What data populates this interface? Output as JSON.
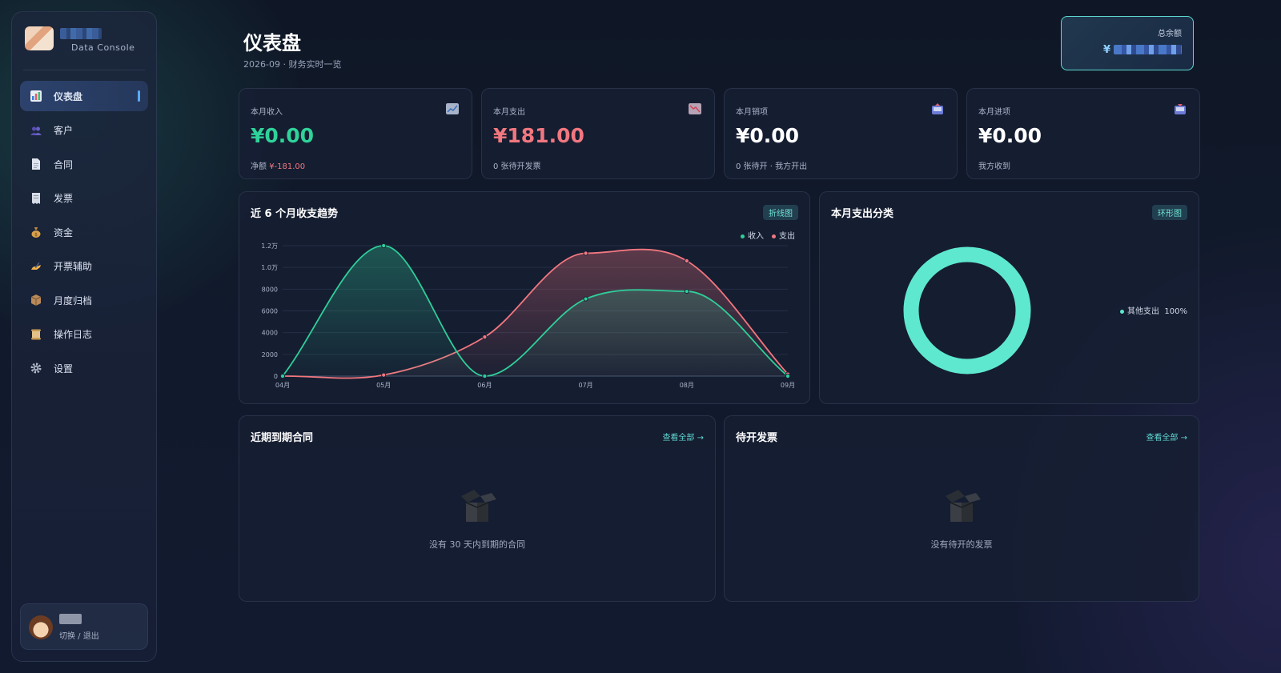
{
  "sidebar": {
    "brand_name": "",
    "brand_sub": "Data Console",
    "items": [
      {
        "label": "仪表盘",
        "icon": "bar-chart-icon",
        "active": true
      },
      {
        "label": "客户",
        "icon": "users-icon"
      },
      {
        "label": "合同",
        "icon": "document-icon"
      },
      {
        "label": "发票",
        "icon": "receipt-icon"
      },
      {
        "label": "资金",
        "icon": "money-bag-icon"
      },
      {
        "label": "开票辅助",
        "icon": "writing-hand-icon"
      },
      {
        "label": "月度归档",
        "icon": "package-icon"
      },
      {
        "label": "操作日志",
        "icon": "scroll-icon"
      },
      {
        "label": "设置",
        "icon": "gear-icon"
      }
    ],
    "user": {
      "name": "",
      "action": "切换 / 退出"
    }
  },
  "header": {
    "title": "仪表盘",
    "subtitle": "2026-09 · 财务实时一览",
    "balance": {
      "label": "总余额",
      "prefix": "¥"
    }
  },
  "stats": [
    {
      "label": "本月收入",
      "value": "¥0.00",
      "note_prefix": "净额 ",
      "note_value": "¥-181.00",
      "icon": "trend-up-icon",
      "color": "#2fd39a"
    },
    {
      "label": "本月支出",
      "value": "¥181.00",
      "note": "0 张待开发票",
      "icon": "trend-down-icon",
      "color": "#f2777f"
    },
    {
      "label": "本月销项",
      "value": "¥0.00",
      "note": "0 张待开 · 我方开出",
      "icon": "outbox-icon",
      "color": "#ffffff"
    },
    {
      "label": "本月进项",
      "value": "¥0.00",
      "note": "我方收到",
      "icon": "inbox-icon",
      "color": "#ffffff"
    }
  ],
  "trend_panel": {
    "title": "近 6 个月收支趋势",
    "badge": "折线图",
    "legend": [
      "收入",
      "支出"
    ]
  },
  "category_panel": {
    "title": "本月支出分类",
    "badge": "环形图",
    "legend_label": "其他支出",
    "legend_value": "100%"
  },
  "contracts_panel": {
    "title": "近期到期合同",
    "view_all": "查看全部 →",
    "empty_text": "没有 30 天内到期的合同"
  },
  "invoices_panel": {
    "title": "待开发票",
    "view_all": "查看全部 →",
    "empty_text": "没有待开的发票"
  },
  "colors": {
    "income": "#2fcf9a",
    "expense": "#f2777f",
    "donut": "#5ee8d0",
    "accent": "#5fd8d0"
  },
  "chart_data": [
    {
      "type": "line",
      "title": "近 6 个月收支趋势",
      "categories": [
        "04月",
        "05月",
        "06月",
        "07月",
        "08月",
        "09月"
      ],
      "series": [
        {
          "name": "收入",
          "values": [
            0,
            12000,
            0,
            7100,
            7800,
            0
          ]
        },
        {
          "name": "支出",
          "values": [
            0,
            100,
            3600,
            11300,
            10600,
            181
          ]
        }
      ],
      "y_ticks": [
        "0",
        "2000",
        "4000",
        "6000",
        "8000",
        "1.0万",
        "1.2万"
      ],
      "ylim": [
        0,
        12000
      ],
      "grid": true,
      "legend": "top-right"
    },
    {
      "type": "pie",
      "title": "本月支出分类",
      "labels": [
        "其他支出"
      ],
      "values": [
        100
      ],
      "legend": "right"
    }
  ]
}
